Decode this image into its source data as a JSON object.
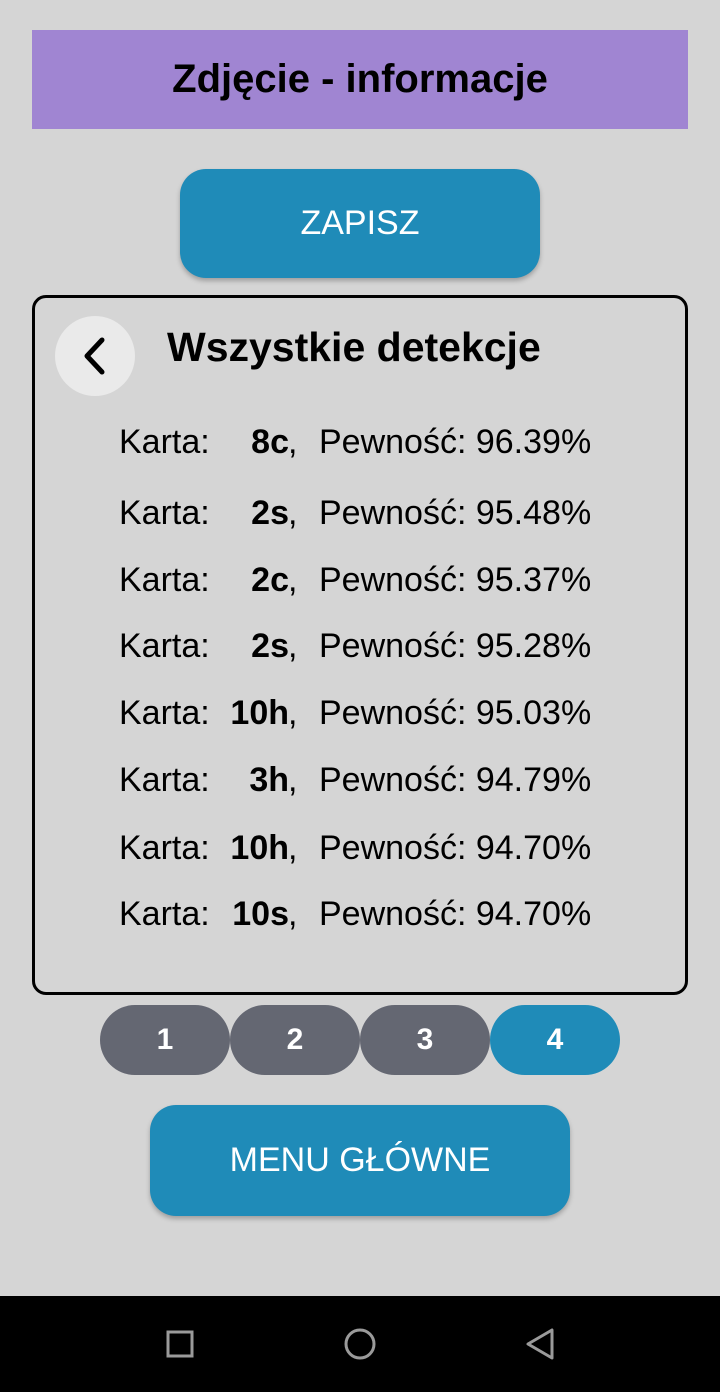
{
  "header": {
    "title": "Zdjęcie - informacje"
  },
  "actions": {
    "save_label": "ZAPISZ",
    "main_menu_label": "MENU GŁÓWNE"
  },
  "panel": {
    "title": "Wszystkie detekcje",
    "back_icon": "chevron-left-icon",
    "card_prefix": "Karta:",
    "separator": ",",
    "confidence_label": "Pewność:",
    "rows": [
      {
        "card": "8c",
        "confidence": "96.39%"
      },
      {
        "card": "2s",
        "confidence": "95.48%"
      },
      {
        "card": "2c",
        "confidence": "95.37%"
      },
      {
        "card": "2s",
        "confidence": "95.28%"
      },
      {
        "card": "10h",
        "confidence": "95.03%"
      },
      {
        "card": "3h",
        "confidence": "94.79%"
      },
      {
        "card": "10h",
        "confidence": "94.70%"
      },
      {
        "card": "10s",
        "confidence": "94.70%"
      }
    ]
  },
  "pagination": {
    "pages": [
      "1",
      "2",
      "3",
      "4"
    ],
    "active_index": 3,
    "active_color": "#1f8bb8",
    "inactive_color": "#646772"
  },
  "system_nav": {
    "icons": [
      "recents-square-icon",
      "home-circle-icon",
      "back-triangle-icon"
    ]
  },
  "colors": {
    "accent": "#1f8bb8",
    "title_bar": "#a085d2",
    "background": "#d5d5d5"
  }
}
